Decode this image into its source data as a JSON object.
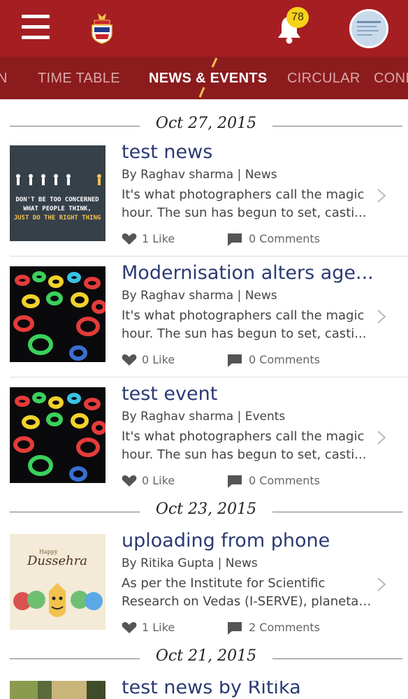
{
  "header": {
    "notification_count": "78"
  },
  "tabs": [
    {
      "label": "N"
    },
    {
      "label": "TIME TABLE"
    },
    {
      "label": "NEWS & EVENTS"
    },
    {
      "label": "CIRCULAR"
    },
    {
      "label": "CONI"
    }
  ],
  "groups": [
    {
      "date": "Oct 27, 2015"
    },
    {
      "date": "Oct 23, 2015"
    },
    {
      "date": "Oct 21, 2015"
    }
  ],
  "items": [
    {
      "title": "test news",
      "author": "By Raghav sharma",
      "separator": "|",
      "category": "News",
      "excerpt_line1": "It's what photographers call the magic",
      "excerpt_line2": "hour. The sun has begun to set, casti...",
      "likes": "1 Like",
      "comments": "0 Comments",
      "thumb_text": [
        "DON'T BE TOO CONCERNED",
        "WHAT PEOPLE THINK,",
        "JUST DO THE RIGHT THING"
      ]
    },
    {
      "title": "Modernisation alters age...",
      "author": "By Raghav sharma",
      "separator": "|",
      "category": "News",
      "excerpt_line1": "It's what photographers call the magic",
      "excerpt_line2": "hour. The sun has begun to set, casti...",
      "likes": "0 Like",
      "comments": "0 Comments"
    },
    {
      "title": "test event",
      "author": "By Raghav sharma",
      "separator": "|",
      "category": "Events",
      "excerpt_line1": "It's what photographers call the magic",
      "excerpt_line2": "hour. The sun has begun to set, casti...",
      "likes": "0 Like",
      "comments": "0 Comments"
    },
    {
      "title": "uploading from phone",
      "author": "By Ritika Gupta",
      "separator": "|",
      "category": "News",
      "excerpt_line1": "As per the Institute for Scientific",
      "excerpt_line2": "Research on Vedas (I-SERVE), planetar...",
      "likes": "1 Like",
      "comments": "2 Comments",
      "thumb_text": [
        "Happy",
        "Dussehra"
      ]
    },
    {
      "title": "test news by Ritika"
    }
  ],
  "colors": {
    "appbar": "#a41e22",
    "tabbar": "#8c1b1d",
    "title": "#2b3a73",
    "badge": "#f6d31a"
  }
}
